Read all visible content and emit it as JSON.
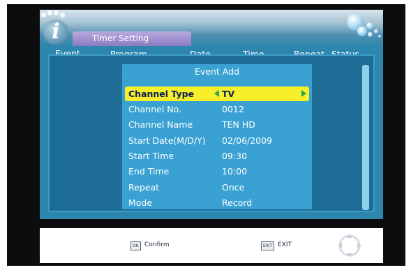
{
  "title": "Timer Setting",
  "columns": [
    "Event",
    "Program",
    "Date",
    "Time",
    "Repeat",
    "Status"
  ],
  "dialog": {
    "title": "Event Add",
    "rows": [
      {
        "label": "Channel Type",
        "value": "TV",
        "selected": true
      },
      {
        "label": "Channel No.",
        "value": "0012"
      },
      {
        "label": "Channel Name",
        "value": "TEN HD"
      },
      {
        "label": "Start Date(M/D/Y)",
        "value": "02/06/2009"
      },
      {
        "label": "Start Time",
        "value": "09:30"
      },
      {
        "label": "End Time",
        "value": "10:00"
      },
      {
        "label": "Repeat",
        "value": "Once"
      },
      {
        "label": "Mode",
        "value": "Record"
      }
    ]
  },
  "footer": {
    "ok_key": "OK",
    "ok_label": "Confirm",
    "exit_key": "EXIT",
    "exit_label": "EXIT"
  },
  "colors": {
    "screen_bg": "#2d86ad",
    "dialog_bg": "#3aa1d3",
    "highlight": "#f6ef2a",
    "title_tab": "#9d8fcf"
  },
  "icons": {
    "logo": "info-i-icon",
    "bubbles": "bubbles-icon",
    "nav": "dpad-icon"
  }
}
